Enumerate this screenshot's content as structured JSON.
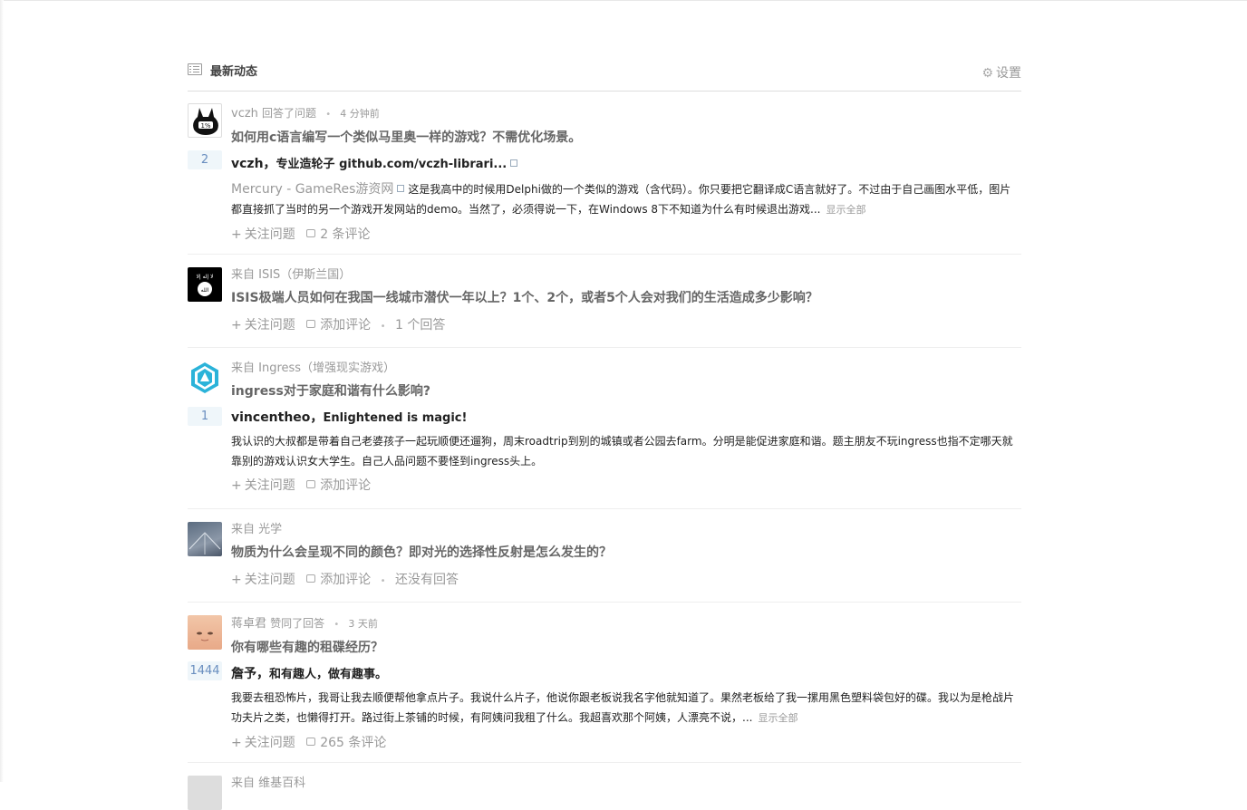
{
  "feed": {
    "title": "最新动态",
    "settings_label": "设置",
    "items": [
      {
        "user": "vczh",
        "action": "回答了问题",
        "time": "4 分钟前",
        "question": "如何用c语言编写一个类似马里奥一样的游戏？不需优化场景。",
        "votes": "2",
        "answerer": "vczh，",
        "answerer_bio": "专业造轮子 github.com/vczh-librari...",
        "source": "Mercury - GameRes游资网",
        "summary": "这是我高中的时候用Delphi做的一个类似的游戏（含代码）。你只要把它翻译成C语言就好了。不过由于自己画图水平低，图片都直接抓了当时的另一个游戏开发网站的demo。当然了，必须得说一下，在Windows 8下不知道为什么有时候退出游戏...",
        "show_all": "显示全部",
        "follow": "关注问题",
        "comment": "2 条评论"
      },
      {
        "from": "来自 ISIS（伊斯兰国）",
        "question": "ISIS极端人员如何在我国一线城市潜伏一年以上？1个、2个，或者5个人会对我们的生活造成多少影响？",
        "follow": "关注问题",
        "comment": "添加评论",
        "answers": "1 个回答"
      },
      {
        "from": "来自 Ingress（增强现实游戏）",
        "question": "ingress对于家庭和谐有什么影响?",
        "votes": "1",
        "answerer": "vincentheo，",
        "answerer_bio": "Enlightened is magic!",
        "summary": "我认识的大叔都是带着自己老婆孩子一起玩顺便还遛狗，周末roadtrip到别的城镇或者公园去farm。分明是能促进家庭和谐。题主朋友不玩ingress也指不定哪天就靠别的游戏认识女大学生。自己人品问题不要怪到ingress头上。",
        "follow": "关注问题",
        "comment": "添加评论"
      },
      {
        "from": "来自 光学",
        "question": "物质为什么会呈现不同的颜色？即对光的选择性反射是怎么发生的？",
        "follow": "关注问题",
        "comment": "添加评论",
        "answers": "还没有回答"
      },
      {
        "user": "蒋卓君",
        "action": "赞同了回答",
        "time": "3 天前",
        "question": "你有哪些有趣的租碟经历？",
        "votes": "1444",
        "answerer": "詹予，",
        "answerer_bio": "和有趣人，做有趣事。",
        "summary": "我要去租恐怖片，我哥让我去顺便帮他拿点片子。我说什么片子，他说你跟老板说我名字他就知道了。果然老板给了我一摞用黑色塑料袋包好的碟。我以为是枪战片功夫片之类，也懒得打开。路过街上茶铺的时候，有阿姨问我租了什么。我超喜欢那个阿姨，人漂亮不说，...",
        "show_all": "显示全部",
        "follow": "关注问题",
        "comment": "265 条评论"
      },
      {
        "from": "来自 维基百科"
      }
    ]
  },
  "icons": {
    "header": "list-icon",
    "settings": "gear-icon",
    "follow": "plus-icon",
    "comment": "comment-bubble-icon",
    "external": "external-link-icon"
  },
  "colors": {
    "vote_bg": "#eff6fa",
    "vote_text": "#698ebf",
    "muted": "#999999"
  }
}
